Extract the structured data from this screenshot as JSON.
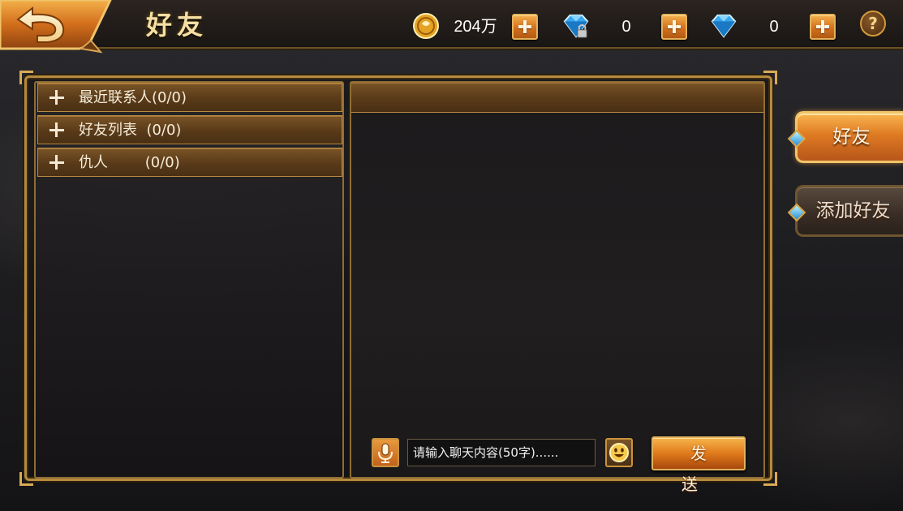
{
  "header": {
    "title": "好友",
    "gold_amount": "204万",
    "bound_diamond_amount": "0",
    "diamond_amount": "0",
    "help_label": "?"
  },
  "friend_groups": [
    {
      "label": "最近联系人(0/0)"
    },
    {
      "label": "好友列表  (0/0)"
    },
    {
      "label": "仇人        (0/0)"
    }
  ],
  "chat": {
    "input_placeholder": "请输入聊天内容(50字)......",
    "send_label": "发 送"
  },
  "side_tabs": [
    {
      "label": "好友",
      "active": true
    },
    {
      "label": "添加好友",
      "active": false
    }
  ],
  "icons": {
    "back": "back-arrow-icon",
    "gold": "gold-coin-icon",
    "bound_diamond": "locked-diamond-icon",
    "diamond": "diamond-icon",
    "add": "plus-icon",
    "help": "question-mark-icon",
    "voice": "microphone-icon",
    "emoji": "smiley-face-icon"
  },
  "colors": {
    "accent_orange": "#df7a22",
    "frame_gold": "#b68a3e",
    "title_text": "#f5dfa3",
    "diamond_blue": "#2b8fd6"
  }
}
